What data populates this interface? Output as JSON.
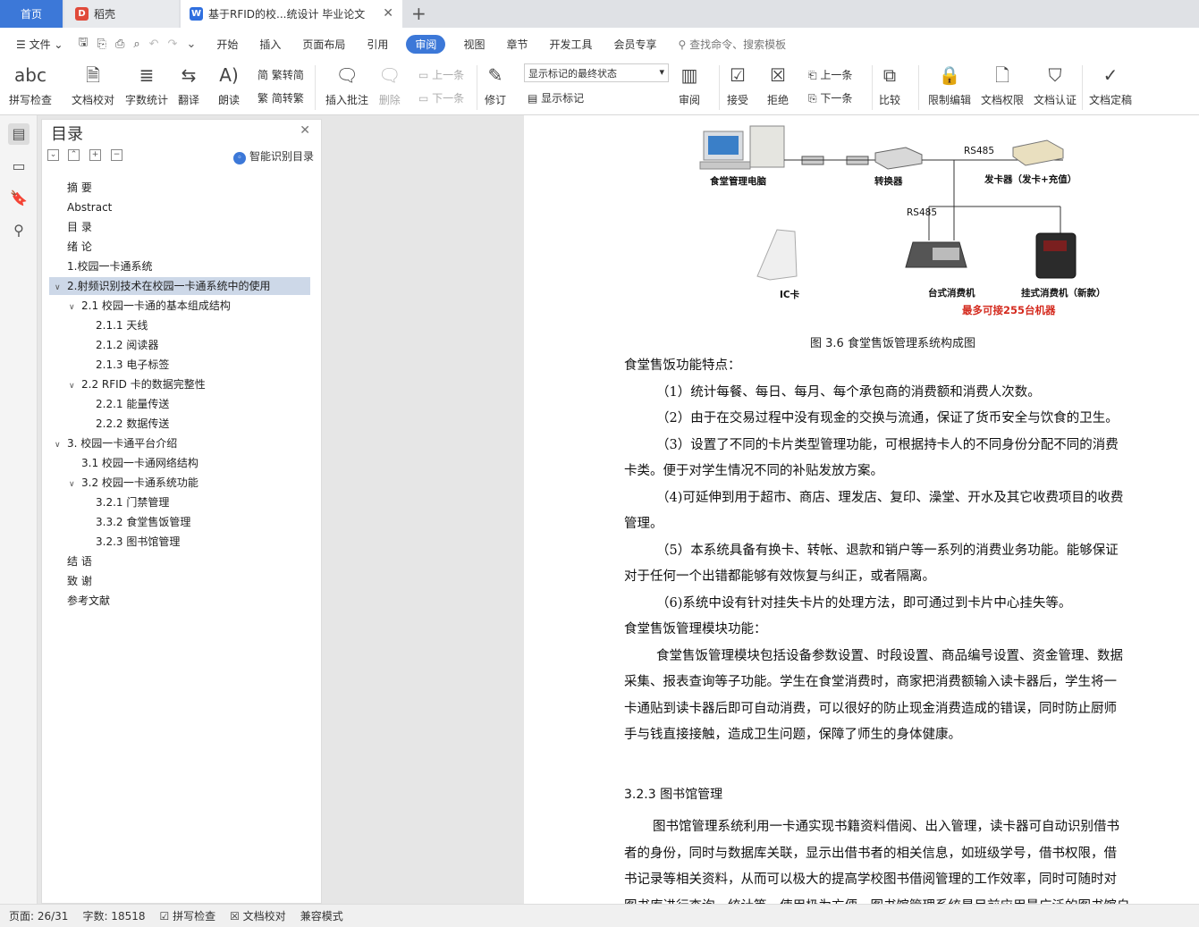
{
  "tabs": {
    "home": "首页",
    "doc": "稻壳",
    "active": "基于RFID的校...统设计 毕业论文"
  },
  "menubar": {
    "file": "文件",
    "items": [
      "开始",
      "插入",
      "页面布局",
      "引用",
      "审阅",
      "视图",
      "章节",
      "开发工具",
      "会员专享"
    ],
    "active_index": 4,
    "search_placeholder": "查找命令、搜索模板"
  },
  "ribbon": {
    "spell": "拼写检查",
    "proof": "文档校对",
    "wordcount": "字数统计",
    "translate": "翻译",
    "read": "朗读",
    "trad": "繁转简",
    "simp": "简转繁",
    "comment": "插入批注",
    "delete": "删除",
    "prev": "上一条",
    "next": "下一条",
    "track": "修订",
    "markup_state": "显示标记的最终状态",
    "show_markup": "显示标记",
    "review": "审阅",
    "accept": "接受",
    "reject": "拒绝",
    "prev2": "上一条",
    "next2": "下一条",
    "compare": "比较",
    "restrict": "限制编辑",
    "perm": "文档权限",
    "auth": "文档认证",
    "final": "文档定稿"
  },
  "toc": {
    "title": "目录",
    "smart": "智能识别目录",
    "items": [
      {
        "text": "摘  要",
        "level": 0
      },
      {
        "text": "Abstract",
        "level": 0
      },
      {
        "text": "目  录",
        "level": 0
      },
      {
        "text": "绪  论",
        "level": 0
      },
      {
        "text": "1.校园一卡通系统",
        "level": 0
      },
      {
        "text": "2.射频识别技术在校园一卡通系统中的使用",
        "level": 0,
        "caret": "∨",
        "selected": true
      },
      {
        "text": "2.1 校园一卡通的基本组成结构",
        "level": 1,
        "caret": "∨"
      },
      {
        "text": "2.1.1  天线",
        "level": 2
      },
      {
        "text": "2.1.2  阅读器",
        "level": 2
      },
      {
        "text": "2.1.3  电子标签",
        "level": 2
      },
      {
        "text": "2.2 RFID 卡的数据完整性",
        "level": 1,
        "caret": "∨"
      },
      {
        "text": "2.2.1  能量传送",
        "level": 2
      },
      {
        "text": "2.2.2  数据传送",
        "level": 2
      },
      {
        "text": "3.  校园一卡通平台介绍",
        "level": 0,
        "caret": "∨"
      },
      {
        "text": "3.1 校园一卡通网络结构",
        "level": 1
      },
      {
        "text": "3.2 校园一卡通系统功能",
        "level": 1,
        "caret": "∨"
      },
      {
        "text": "3.2.1 门禁管理",
        "level": 2
      },
      {
        "text": "3.3.2 食堂售饭管理",
        "level": 2
      },
      {
        "text": "3.2.3 图书馆管理",
        "level": 2
      },
      {
        "text": "结  语",
        "level": 0
      },
      {
        "text": "致    谢",
        "level": 0
      },
      {
        "text": "参考文献",
        "level": 0
      }
    ]
  },
  "figure": {
    "pc": "食堂管理电脑",
    "converter": "转换器",
    "rs485a": "RS485",
    "issuer": "发卡器（发卡+充值）",
    "rs485b": "RS485",
    "ic": "IC卡",
    "desk": "台式消费机",
    "wall": "挂式消费机（新款）",
    "max": "最多可接255台机器",
    "caption": "图 3.6   食堂售饭管理系统构成图"
  },
  "doc": {
    "lines": [
      "食堂售饭功能特点：",
      "（1）统计每餐、每日、每月、每个承包商的消费额和消费人次数。",
      "（2）由于在交易过程中没有现金的交换与流通，保证了货币安全与饮食的卫生。",
      "（3）设置了不同的卡片类型管理功能，可根据持卡人的不同身份分配不同的消费",
      "卡类。便于对学生情况不同的补贴发放方案。",
      "（4)可延伸到用于超市、商店、理发店、复印、澡堂、开水及其它收费项目的收费",
      "管理。",
      "（5）本系统具备有换卡、转帐、退款和销户等一系列的消费业务功能。能够保证",
      "对于任何一个出错都能够有效恢复与纠正，或者隔离。",
      "（6)系统中设有针对挂失卡片的处理方法，即可通过到卡片中心挂失等。",
      "食堂售饭管理模块功能：",
      "食堂售饭管理模块包括设备参数设置、时段设置、商品编号设置、资金管理、数据",
      "采集、报表查询等子功能。学生在食堂消费时，商家把消费额输入读卡器后，学生将一",
      "卡通贴到读卡器后即可自动消费，可以很好的防止现金消费造成的错误，同时防止厨师",
      "手与钱直接接触，造成卫生问题，保障了师生的身体健康。"
    ],
    "heading": "3.2.3 图书馆管理",
    "lines2": [
      "图书馆管理系统利用一卡通实现书籍资料借阅、出入管理，读卡器可自动识别借书",
      "者的身份，同时与数据库关联，显示出借书者的相关信息，如班级学号，借书权限，借",
      "书记录等相关资料，从而可以极大的提高学校图书借阅管理的工作效率，同时可随时对",
      "图书库进行查询、统计等，使用极为方便。图书馆管理系统是目前应用最广泛的图书馆自"
    ]
  },
  "status": {
    "page": "页面: 26/31",
    "words": "字数: 18518",
    "spell": "拼写检查",
    "proof": "文档校对",
    "compat": "兼容模式"
  }
}
